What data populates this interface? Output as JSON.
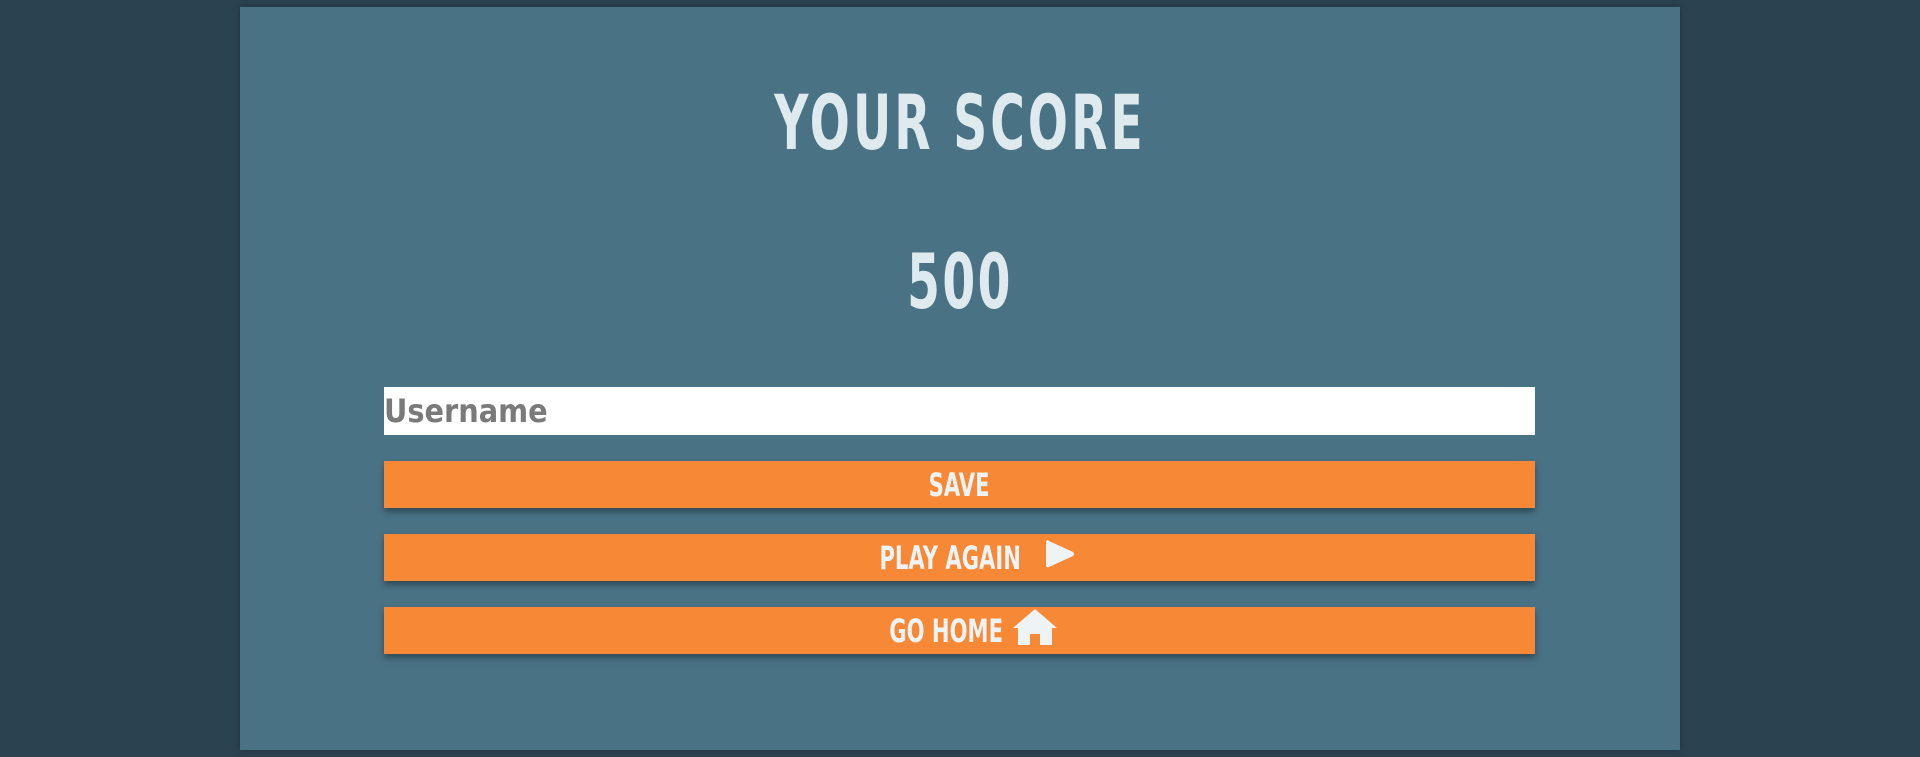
{
  "end_screen": {
    "title": "YOUR SCORE",
    "score": "500"
  },
  "form": {
    "username_placeholder": "Username",
    "username_value": "",
    "save_label": "SAVE",
    "play_again_label": "PLAY AGAIN",
    "go_home_label": "GO HOME"
  },
  "icons": {
    "play_again": "play-icon",
    "go_home": "home-icon"
  },
  "colors": {
    "background": "#2b4250",
    "card": "#497285",
    "heading_text": "#dfeaee",
    "button": "#f68836",
    "button_text": "#eef3f5"
  }
}
